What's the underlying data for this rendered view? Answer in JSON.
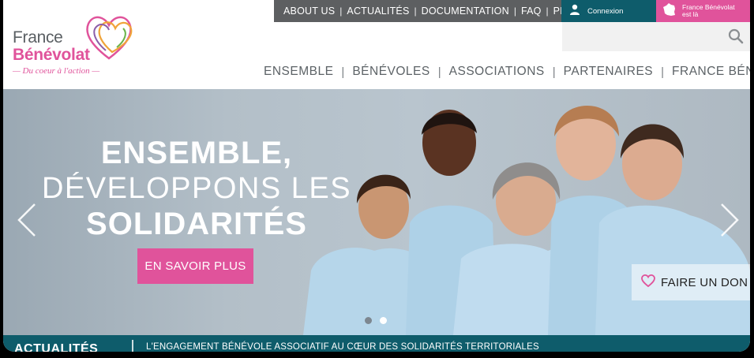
{
  "topnav": {
    "items": [
      "ABOUT US",
      "ACTUALITÉS",
      "DOCUMENTATION",
      "FAQ",
      "PRESSE"
    ],
    "connexion_label": "Connexion",
    "ici_label": "France Bénévolat est là"
  },
  "search": {
    "placeholder": "",
    "icon": "search-icon"
  },
  "logo": {
    "line1": "France",
    "line2": "Bénévolat",
    "tagline": "— Du coeur à l'action —"
  },
  "mainnav": {
    "items": [
      "ENSEMBLE",
      "BÉNÉVOLES",
      "ASSOCIATIONS",
      "PARTENAIRES",
      "FRANCE BÉNÉVOLAT"
    ]
  },
  "hero": {
    "line1": "ENSEMBLE,",
    "line2": "DÉVELOPPONS LES",
    "line3": "SOLIDARITÉS",
    "cta_label": "EN SAVOIR PLUS",
    "donate_label": "FAIRE UN DON",
    "slides": 2,
    "active_slide": 1
  },
  "news": {
    "heading": "ACTUALITÉS",
    "headline": "L'ENGAGEMENT BÉNÉVOLE ASSOCIATIF AU CŒUR DES SOLIDARITÉS TERRITORIALES"
  },
  "colors": {
    "brand_pink": "#e0539b",
    "brand_teal": "#0e5c6b",
    "nav_gray": "#5d5f61",
    "text_gray": "#5c6266"
  }
}
